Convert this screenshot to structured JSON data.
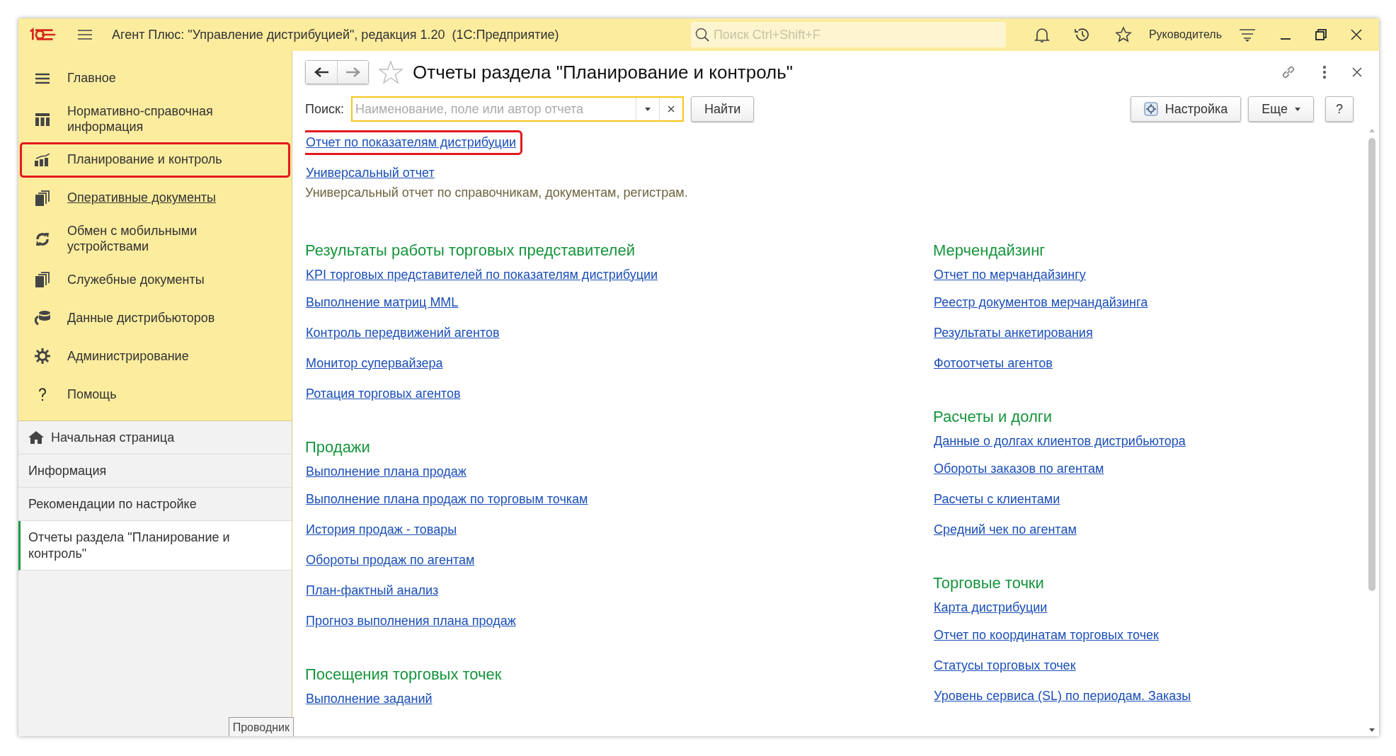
{
  "window": {
    "title": "Агент Плюс: \"Управление дистрибуцией\", редакция 1.20  (1С:Предприятие)",
    "search_placeholder": "Поиск Ctrl+Shift+F",
    "user": "Руководитель"
  },
  "sections": [
    {
      "label": "Главное",
      "selected": false,
      "visited": false
    },
    {
      "label": "Нормативно-справочная информация",
      "selected": false,
      "visited": false
    },
    {
      "label": "Планирование и контроль",
      "selected": true,
      "visited": false
    },
    {
      "label": "Оперативные документы",
      "selected": false,
      "visited": true
    },
    {
      "label": "Обмен с мобильными устройствами",
      "selected": false,
      "visited": false
    },
    {
      "label": "Служебные документы",
      "selected": false,
      "visited": false
    },
    {
      "label": "Данные дистрибьюторов",
      "selected": false,
      "visited": false
    },
    {
      "label": "Администрирование",
      "selected": false,
      "visited": false
    },
    {
      "label": "Помощь",
      "selected": false,
      "visited": false
    }
  ],
  "open_windows": [
    {
      "label": "Начальная страница",
      "home": true,
      "selected": false
    },
    {
      "label": "Информация",
      "home": false,
      "selected": false
    },
    {
      "label": "Рекомендации по настройке",
      "home": false,
      "selected": false
    },
    {
      "label": "Отчеты раздела \"Планирование и контроль\"",
      "home": false,
      "selected": true
    }
  ],
  "explorer_tab": "Проводник",
  "form": {
    "title": "Отчеты раздела \"Планирование и контроль\"",
    "search_label": "Поиск:",
    "search_placeholder": "Наименование, поле или автор отчета",
    "find_button": "Найти",
    "settings_button": "Настройка",
    "more_button": "Еще",
    "help_button": "?"
  },
  "top_reports": [
    {
      "label": "Отчет по показателям дистрибуции",
      "highlighted": true
    },
    {
      "label": "Универсальный отчет",
      "highlighted": false
    }
  ],
  "top_description": "Универсальный отчет по справочникам, документам, регистрам.",
  "columns": [
    [
      {
        "title": "Результаты работы торговых представителей",
        "links": [
          "KPI торговых представителей по показателям дистрибуции",
          "Выполнение матриц MML",
          "Контроль передвижений агентов",
          "Монитор супервайзера",
          "Ротация торговых агентов"
        ]
      },
      {
        "title": "Продажи",
        "links": [
          "Выполнение плана продаж",
          "Выполнение плана продаж по торговым точкам",
          "История продаж - товары",
          "Обороты продаж по агентам",
          "План-фактный анализ",
          "Прогноз выполнения плана продаж"
        ]
      },
      {
        "title": "Посещения торговых точек",
        "links": [
          "Выполнение заданий"
        ]
      }
    ],
    [
      {
        "title": "Мерчендайзинг",
        "links": [
          "Отчет по мерчандайзингу",
          "Реестр документов мерчандайзинга",
          "Результаты анкетирования",
          "Фотоотчеты агентов"
        ]
      },
      {
        "title": "Расчеты и долги",
        "links": [
          "Данные о долгах клиентов дистрибьютора",
          "Обороты заказов по агентам",
          "Расчеты с клиентами",
          "Средний чек по агентам"
        ]
      },
      {
        "title": "Торговые точки",
        "links": [
          "Карта дистрибуции",
          "Отчет по координатам торговых точек",
          "Статусы торговых точек",
          "Уровень сервиса (SL) по периодам. Заказы"
        ]
      }
    ]
  ]
}
